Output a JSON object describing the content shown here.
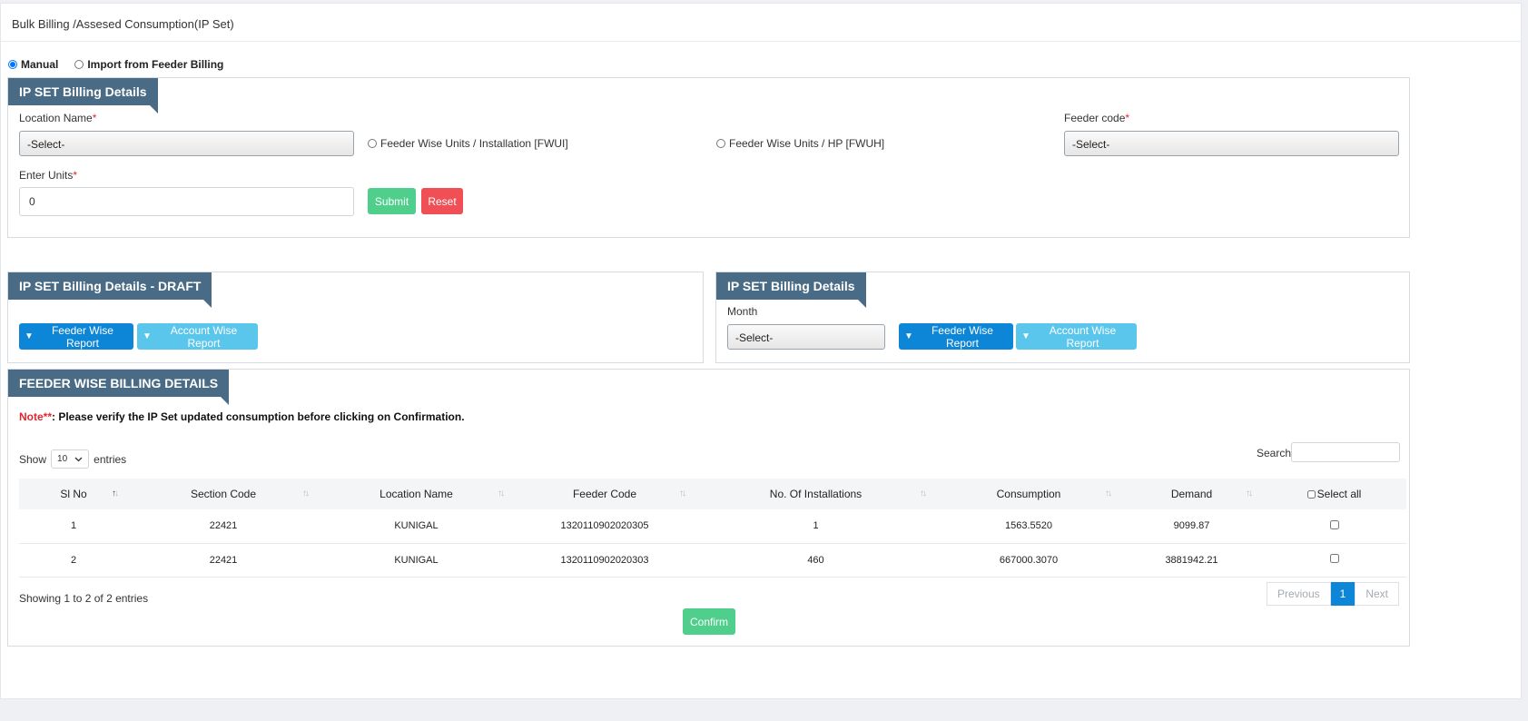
{
  "page": {
    "title": "Bulk Billing /Assesed Consumption(IP Set)"
  },
  "mode": {
    "options": [
      "Manual",
      "Import from Feeder Billing"
    ],
    "selected": "Manual"
  },
  "billing_form": {
    "heading": "IP SET Billing Details",
    "location_label": "Location Name",
    "location_value": "-Select-",
    "radio_fwui": "Feeder Wise Units / Installation [FWUI]",
    "radio_fwuh": "Feeder Wise Units / HP [FWUH]",
    "feeder_label": "Feeder code",
    "feeder_value": "-Select-",
    "units_label": "Enter Units",
    "units_value": "0",
    "submit": "Submit",
    "reset": "Reset",
    "required_mark": "*"
  },
  "draft_panel": {
    "heading": "IP SET Billing Details - DRAFT",
    "feeder_report": "Feeder Wise Report",
    "account_report": "Account Wise Report"
  },
  "monthly_panel": {
    "heading": "IP SET Billing Details",
    "month_label": "Month",
    "month_value": "-Select-",
    "feeder_report": "Feeder Wise Report",
    "account_report": "Account Wise Report"
  },
  "feeder_details": {
    "heading": "FEEDER WISE BILLING DETAILS",
    "note_label": "Note**",
    "note_text": ": Please verify the IP Set updated consumption before clicking on Confirmation.",
    "show_label": "Show",
    "entries_value": "10",
    "entries_label": "entries",
    "search_label": "Search:",
    "columns": [
      "Sl No",
      "Section Code",
      "Location Name",
      "Feeder Code",
      "No. Of Installations",
      "Consumption",
      "Demand",
      "Select all"
    ],
    "rows": [
      {
        "sl": "1",
        "section": "22421",
        "location": "KUNIGAL",
        "feeder": "1320110902020305",
        "installations": "1",
        "consumption": "1563.5520",
        "demand": "9099.87"
      },
      {
        "sl": "2",
        "section": "22421",
        "location": "KUNIGAL",
        "feeder": "1320110902020303",
        "installations": "460",
        "consumption": "667000.3070",
        "demand": "3881942.21"
      }
    ],
    "info": "Showing 1 to 2 of 2 entries",
    "prev": "Previous",
    "page": "1",
    "next": "Next",
    "confirm": "Confirm"
  },
  "icons": {
    "dropdown_triangle": "▼",
    "chevron": "chevron-down-icon",
    "sort": "sort-icon"
  }
}
